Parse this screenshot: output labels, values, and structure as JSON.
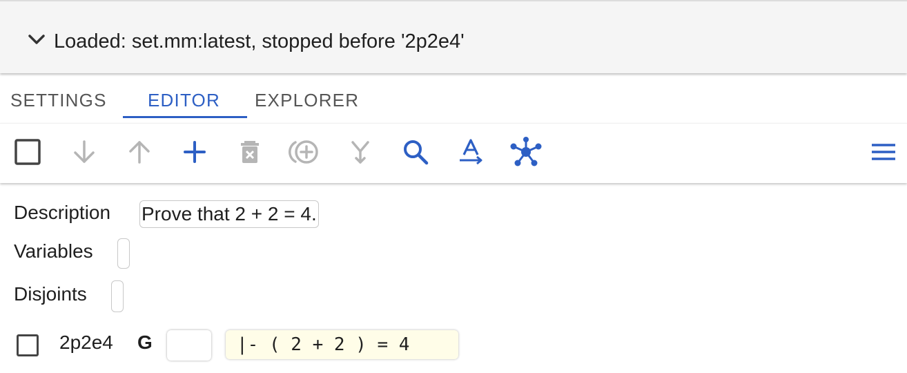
{
  "accordion": {
    "title": "Loaded: set.mm:latest, stopped before '2p2e4'",
    "icon": "chevron-down-icon"
  },
  "tabs": [
    {
      "label": "SETTINGS",
      "active": false
    },
    {
      "label": "EDITOR",
      "active": true
    },
    {
      "label": "EXPLORER",
      "active": false
    }
  ],
  "toolbar": {
    "accent_color": "#2d5fc4",
    "disabled_color": "#b5b5b5",
    "buttons": [
      {
        "icon": "checkbox-icon",
        "enabled": true
      },
      {
        "icon": "arrow-down-icon",
        "enabled": false
      },
      {
        "icon": "arrow-up-icon",
        "enabled": false
      },
      {
        "icon": "plus-icon",
        "enabled": true
      },
      {
        "icon": "delete-icon",
        "enabled": false
      },
      {
        "icon": "add-circle-icon",
        "enabled": false
      },
      {
        "icon": "merge-icon",
        "enabled": false
      },
      {
        "icon": "search-icon",
        "enabled": true
      },
      {
        "icon": "text-substitute-icon",
        "enabled": true
      },
      {
        "icon": "graph-icon",
        "enabled": true
      },
      {
        "icon": "menu-icon",
        "enabled": true
      }
    ]
  },
  "editor": {
    "description_label": "Description",
    "description_value": "Prove that 2 + 2 = 4.",
    "variables_label": "Variables",
    "variables_value": "",
    "disjoints_label": "Disjoints",
    "disjoints_value": "",
    "steps": [
      {
        "label": "2p2e4",
        "type": "G",
        "justification": "",
        "expression": "|- ( 2 + 2 ) = 4"
      }
    ]
  }
}
